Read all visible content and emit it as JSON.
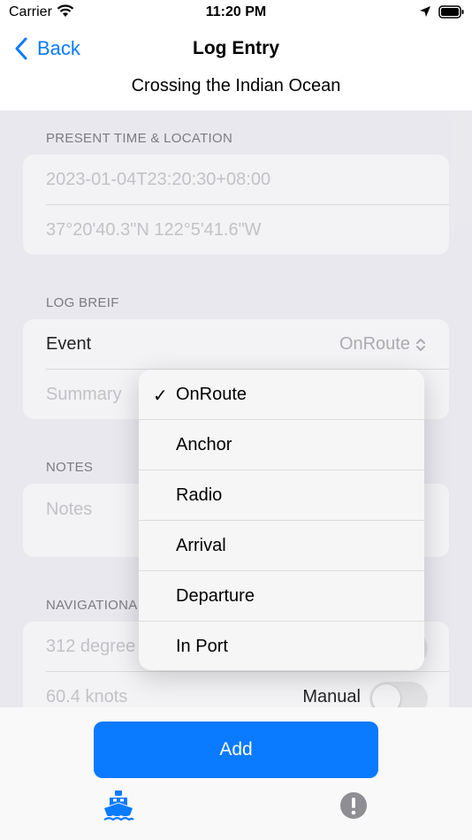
{
  "status_bar": {
    "carrier": "Carrier",
    "time": "11:20 PM"
  },
  "nav": {
    "back_label": "Back",
    "title": "Log Entry",
    "subtitle": "Crossing the Indian Ocean"
  },
  "present": {
    "header": "PRESENT TIME & LOCATION",
    "time_value": "2023-01-04T23:20:30+08:00",
    "location_value": "37°20'40.3\"N 122°5'41.6\"W"
  },
  "brief": {
    "header": "LOG BREIF",
    "event_label": "Event",
    "event_value": "OnRoute",
    "summary_placeholder": "Summary"
  },
  "notes": {
    "header": "NOTES",
    "placeholder": "Notes"
  },
  "navigation": {
    "header": "NAVIGATIONA",
    "heading_value": "312 degree",
    "speed_value": "60.4 knots",
    "manual_label": "Manual"
  },
  "dropdown": {
    "selected_mark": "✓",
    "options": [
      "OnRoute",
      "Anchor",
      "Radio",
      "Arrival",
      "Departure",
      "In Port"
    ]
  },
  "actions": {
    "add_label": "Add"
  },
  "colors": {
    "accent": "#0a7aff",
    "background": "#f2f2f7",
    "placeholder": "#c4c4c7"
  }
}
